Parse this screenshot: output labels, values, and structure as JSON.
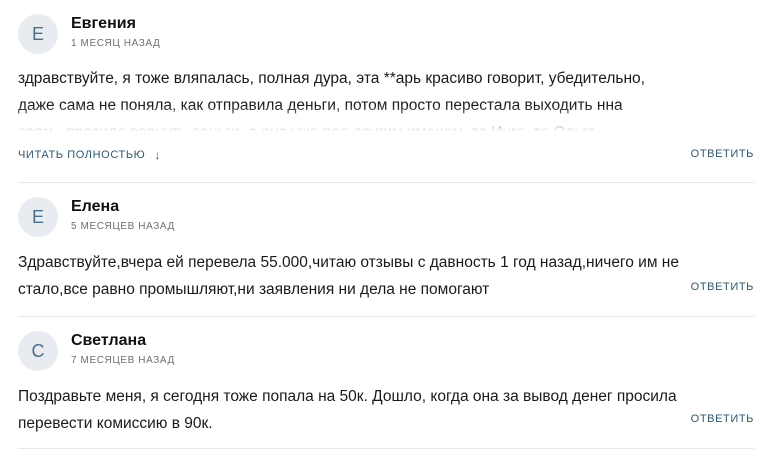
{
  "comments": [
    {
      "avatar": "Е",
      "author": "Евгения",
      "date": "1 месяц назад",
      "text": "здравствуйте, я тоже вляпалась, полная дура, эта **арь красиво говорит, убедительно, даже сама не поняла, как отправила деньги, потом просто перестала выходить нна связь, просила вернуть деньги, а она уже под другим именем, то Инга, то Ольга, бессовестная",
      "read_more": "Читать полностью",
      "reply": "Ответить"
    },
    {
      "avatar": "Е",
      "author": "Елена",
      "date": "5 месяцев назад",
      "text": "Здравствуйте,вчера ей перевела 55.000,читаю отзывы с давность 1 год назад,ничего им не стало,все равно промышляют,ни заявления ни дела не помогают",
      "reply": "Ответить"
    },
    {
      "avatar": "С",
      "author": "Светлана",
      "date": "7 месяцев назад",
      "text": "Поздравьте меня, я сегодня тоже попала на 50к. Дошло, когда она за вывод денег просила перевести комиссию в 90к.",
      "reply": "Ответить"
    }
  ],
  "icons": {
    "read_more_arrow": "arrow-down-icon"
  }
}
